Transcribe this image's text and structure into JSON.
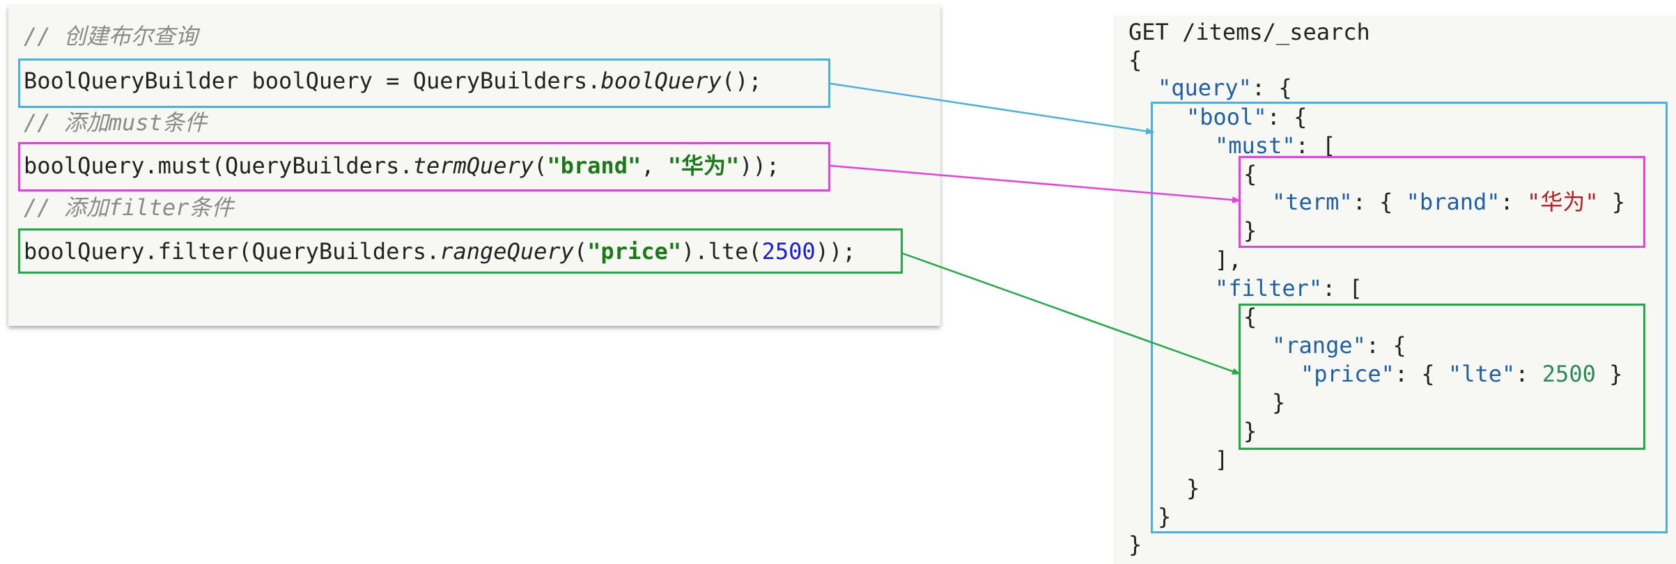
{
  "java": {
    "comment1": "// 创建布尔查询",
    "line1": {
      "prefix": "BoolQueryBuilder boolQuery = QueryBuilders.",
      "method": "boolQuery",
      "suffix": "();"
    },
    "comment2": "// 添加must条件",
    "line2": {
      "prefix": "boolQuery.must(QueryBuilders.",
      "method": "termQuery",
      "open": "(",
      "arg1": "\"brand\"",
      "sep": ", ",
      "arg2": "\"华为\"",
      "suffix": "));"
    },
    "comment3": "// 添加filter条件",
    "line3": {
      "prefix": "boolQuery.filter(QueryBuilders.",
      "method": "rangeQuery",
      "open": "(",
      "arg1": "\"price\"",
      "mid": ").lte(",
      "num": "2500",
      "suffix": "));"
    }
  },
  "dsl": {
    "request": "GET /items/_search",
    "open_brace": "{",
    "query_key": "\"query\"",
    "bool_key": "\"bool\"",
    "must_key": "\"must\"",
    "term_key": "\"term\"",
    "brand_key": "\"brand\"",
    "brand_value": "\"华为\"",
    "filter_key": "\"filter\"",
    "range_key": "\"range\"",
    "price_key": "\"price\"",
    "lte_key": "\"lte\"",
    "lte_value": "2500"
  },
  "colors": {
    "blue_box": "#4ab0de",
    "magenta_box": "#e83fe0",
    "green_box": "#22aa44"
  }
}
